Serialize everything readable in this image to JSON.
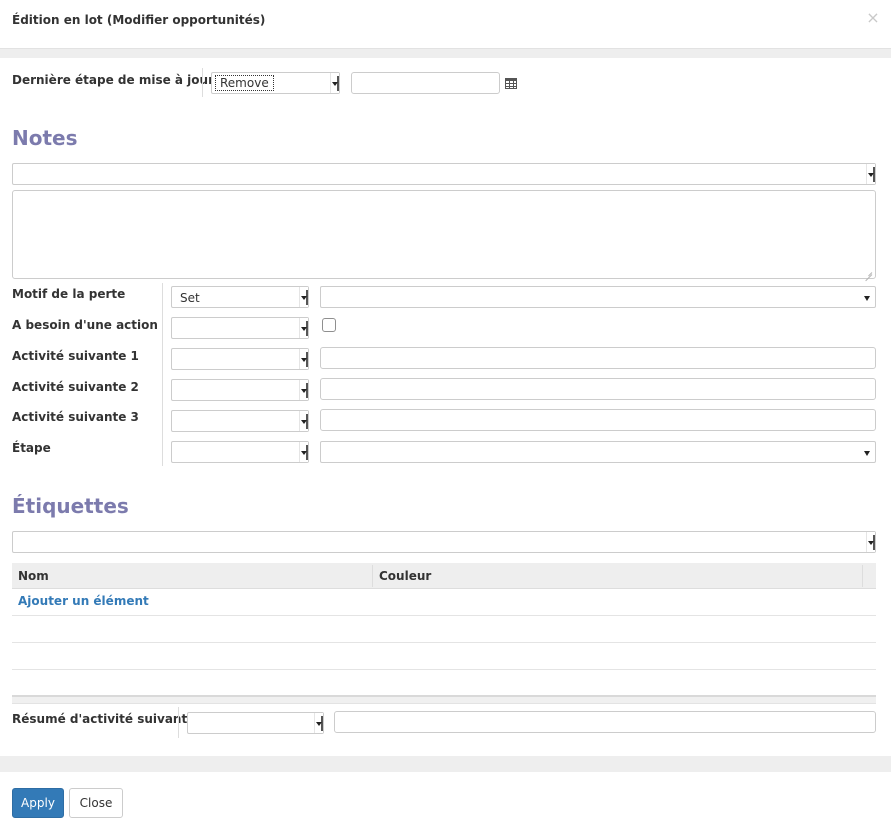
{
  "dialog": {
    "title": "Édition en lot (Modifier opportunités)",
    "close_glyph": "×"
  },
  "last_stage_update": {
    "label": "Dernière étape de mise à jour",
    "action_value": "Remove",
    "date_value": ""
  },
  "notes": {
    "title": "Notes",
    "action_value": "",
    "text": ""
  },
  "fields": [
    {
      "label": "Motif de la perte",
      "action_value": "Set",
      "value": ""
    },
    {
      "label": "A besoin d'une action",
      "action_value": "",
      "checked": false
    },
    {
      "label": "Activité suivante 1",
      "action_value": "",
      "value": ""
    },
    {
      "label": "Activité suivante 2",
      "action_value": "",
      "value": ""
    },
    {
      "label": "Activité suivante 3",
      "action_value": "",
      "value": ""
    },
    {
      "label": "Étape",
      "action_value": "",
      "value": ""
    }
  ],
  "tags": {
    "title": "Étiquettes",
    "action_value": "",
    "columns": [
      "Nom",
      "Couleur"
    ],
    "add_item": "Ajouter un élément"
  },
  "activity_summary": {
    "label": "Résumé d'activité suivant",
    "action_value": "",
    "value": ""
  },
  "footer": {
    "apply_label": "Apply",
    "close_label": "Close"
  },
  "colors": {
    "section_title": "#7c7bad",
    "link": "#337ab7",
    "primary": "#337ab7"
  },
  "icons": {
    "calendar": "calendar-icon",
    "close": "close-icon"
  }
}
